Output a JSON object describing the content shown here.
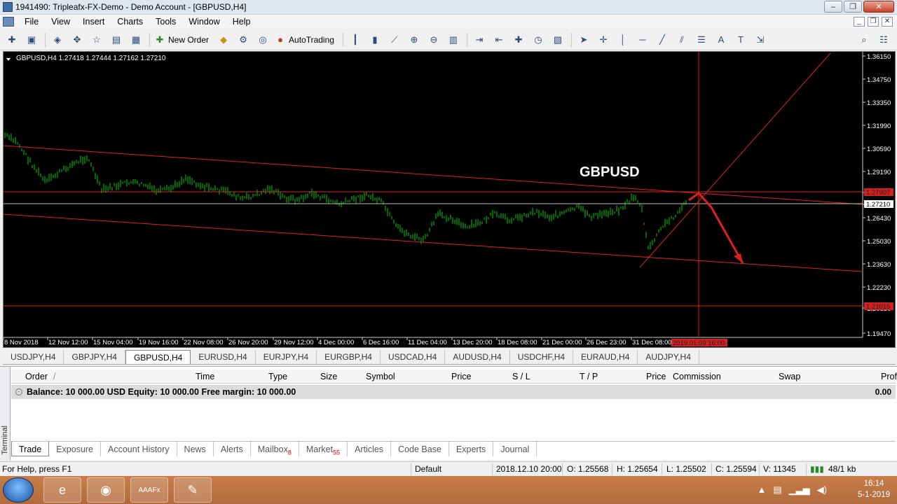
{
  "window": {
    "title": "1941490: Tripleafx-FX-Demo - Demo Account - [GBPUSD,H4]",
    "minimize": "–",
    "maximize": "❐",
    "close": "✕"
  },
  "menu": [
    "File",
    "View",
    "Insert",
    "Charts",
    "Tools",
    "Window",
    "Help"
  ],
  "toolbar": {
    "new_order": "New Order",
    "autotrading": "AutoTrading"
  },
  "chart": {
    "header": "GBPUSD,H4  1.27418 1.27444 1.27162 1.27210",
    "annotation": "GBPUSD",
    "price_labels": [
      "1.36150",
      "1.34750",
      "1.33350",
      "1.31990",
      "1.30590",
      "1.29190",
      "1.27907",
      "1.27210",
      "1.26430",
      "1.25030",
      "1.23630",
      "1.22230",
      "1.20830",
      "1.19470"
    ],
    "highlight_red_label_top": "1.27907",
    "highlight_red_label_bottom": "1.21015",
    "current_price_label": "1.27210",
    "time_labels": [
      "8 Nov 2018",
      "12 Nov 12:00",
      "15 Nov 04:00",
      "19 Nov 16:00",
      "22 Nov 08:00",
      "26 Nov 20:00",
      "29 Nov 12:00",
      "4 Dec 00:00",
      "6 Dec 16:00",
      "11 Dec 04:00",
      "13 Dec 20:00",
      "18 Dec 08:00",
      "21 Dec 00:00",
      "26 Dec 23:00",
      "31 Dec 08:00"
    ],
    "crosshair_time_label": "2019.01.09 16:00",
    "colors": {
      "background": "#000000",
      "bars": "#00d000",
      "lines": "#e02020"
    }
  },
  "chart_tabs": [
    "USDJPY,H4",
    "GBPJPY,H4",
    "GBPUSD,H4",
    "EURUSD,H4",
    "EURJPY,H4",
    "EURGBP,H4",
    "USDCAD,H4",
    "AUDUSD,H4",
    "USDCHF,H4",
    "EURAUD,H4",
    "AUDJPY,H4"
  ],
  "chart_tab_active": 2,
  "terminal": {
    "side_label": "Terminal",
    "columns": [
      "Order",
      "/",
      "Time",
      "Type",
      "Size",
      "Symbol",
      "Price",
      "S / L",
      "T / P",
      "Price",
      "Commission",
      "Swap",
      "Profit"
    ],
    "balance_line": "Balance: 10 000.00 USD  Equity: 10 000.00  Free margin: 10 000.00",
    "profit_total": "0.00",
    "tabs": [
      {
        "label": "Trade",
        "badge": ""
      },
      {
        "label": "Exposure",
        "badge": ""
      },
      {
        "label": "Account History",
        "badge": ""
      },
      {
        "label": "News",
        "badge": ""
      },
      {
        "label": "Alerts",
        "badge": ""
      },
      {
        "label": "Mailbox",
        "badge": "8"
      },
      {
        "label": "Market",
        "badge": "55"
      },
      {
        "label": "Articles",
        "badge": ""
      },
      {
        "label": "Code Base",
        "badge": ""
      },
      {
        "label": "Experts",
        "badge": ""
      },
      {
        "label": "Journal",
        "badge": ""
      }
    ]
  },
  "status": {
    "help": "For Help, press F1",
    "profile": "Default",
    "datetime": "2018.12.10 20:00",
    "open": "O: 1.25568",
    "high": "H: 1.25654",
    "low": "L: 1.25502",
    "close": "C: 1.25594",
    "volume": "V: 11345",
    "traffic": "48/1 kb"
  },
  "taskbar": {
    "time": "16:14",
    "date": "5-1-2019",
    "apps": [
      "ie-icon",
      "chrome-icon",
      "aaafx-icon",
      "paint-icon"
    ],
    "app3_label": "AAAFx"
  }
}
